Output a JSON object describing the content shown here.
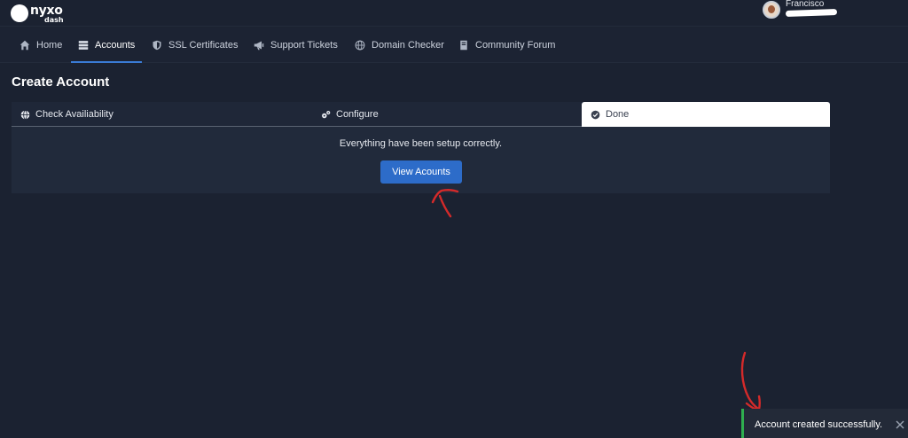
{
  "app": {
    "logo_word": "nyxo",
    "logo_sub": "dash"
  },
  "user": {
    "name": "Francisco"
  },
  "nav": {
    "items": [
      {
        "label": "Home",
        "icon": "home-icon"
      },
      {
        "label": "Accounts",
        "icon": "server-icon",
        "active": true
      },
      {
        "label": "SSL Certificates",
        "icon": "shield-icon"
      },
      {
        "label": "Support Tickets",
        "icon": "megaphone-icon"
      },
      {
        "label": "Domain Checker",
        "icon": "globe-icon"
      },
      {
        "label": "Community Forum",
        "icon": "book-icon"
      }
    ]
  },
  "page": {
    "title": "Create Account"
  },
  "stepper": {
    "steps": [
      {
        "label": "Check Availiability",
        "icon": "globe-icon"
      },
      {
        "label": "Configure",
        "icon": "cogs-icon"
      },
      {
        "label": "Done",
        "icon": "check-circle-icon",
        "active": true
      }
    ]
  },
  "panel": {
    "message": "Everything have been setup correctly.",
    "button_label": "View Acounts"
  },
  "toast": {
    "message": "Account created successfully.",
    "accent": "#2fae4f"
  },
  "colors": {
    "background": "#1b2231",
    "primary": "#2d6cc9",
    "annotation": "#d42a2a"
  }
}
